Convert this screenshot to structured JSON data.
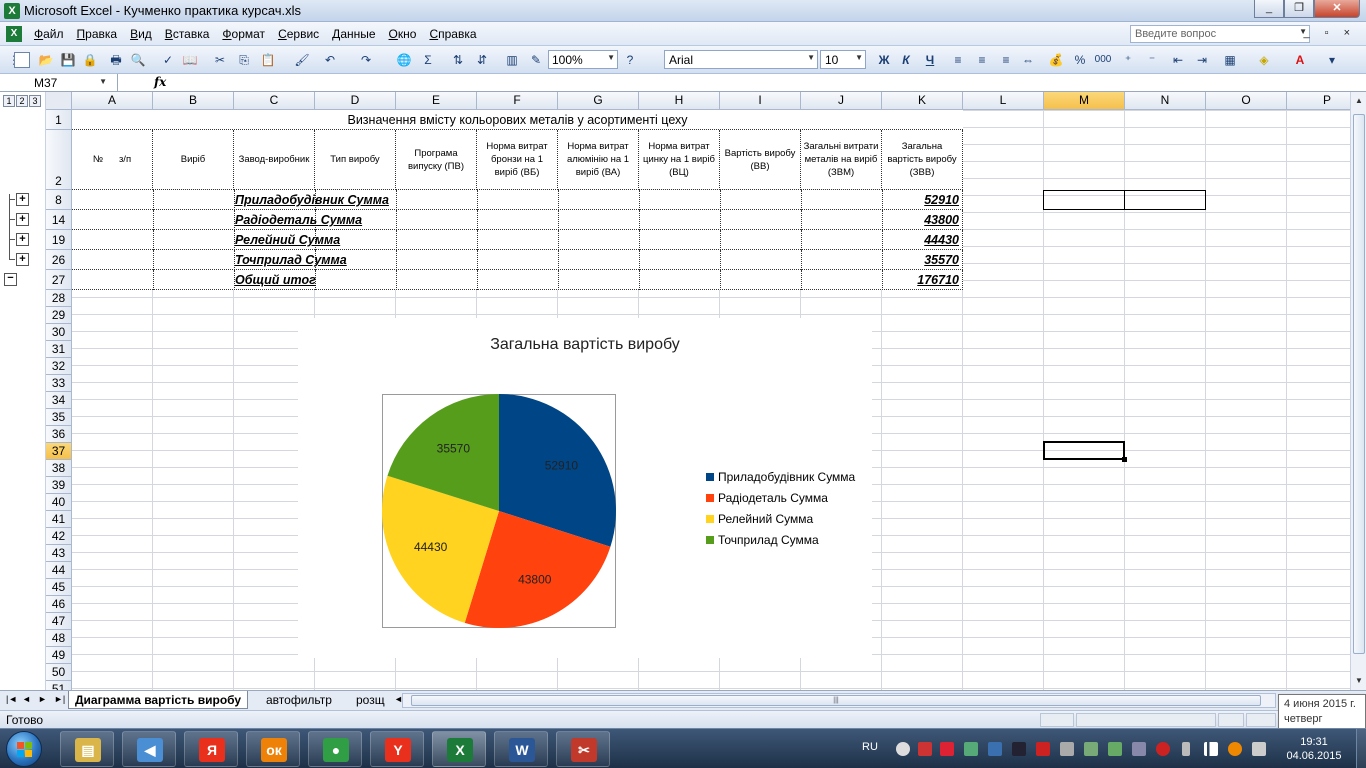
{
  "window": {
    "title": "Microsoft Excel - Кучменко практика курсач.xls",
    "minimize": "_",
    "restore": "❐",
    "close": "✕"
  },
  "menu": {
    "items": [
      "Файл",
      "Правка",
      "Вид",
      "Вставка",
      "Формат",
      "Сервис",
      "Данные",
      "Окно",
      "Справка"
    ],
    "help_placeholder": "Введите вопрос",
    "doc_controls": "_ ▫ ×"
  },
  "toolbar": {
    "zoom": "100%",
    "font": "Arial",
    "font_size": "10",
    "sigma": "Σ",
    "bold": "Ж",
    "italic": "К",
    "underline": "Ч",
    "percent": "%",
    "thousands": "000"
  },
  "formula": {
    "name_box": "M37",
    "fx": "fx",
    "content": ""
  },
  "sheet": {
    "columns": [
      "A",
      "B",
      "C",
      "D",
      "E",
      "F",
      "G",
      "H",
      "I",
      "J",
      "K",
      "L",
      "M",
      "N",
      "O",
      "P"
    ],
    "selected_column": "M",
    "rows": [
      "1",
      "2",
      "8",
      "14",
      "19",
      "26",
      "27",
      "28",
      "29",
      "30",
      "31",
      "32",
      "33",
      "34",
      "35",
      "36",
      "37",
      "38",
      "39",
      "40",
      "41",
      "42",
      "43",
      "44",
      "45",
      "46",
      "47",
      "48",
      "49",
      "50",
      "51"
    ],
    "selected_row": "37",
    "outline_levels": [
      "1",
      "2",
      "3"
    ],
    "title": "Визначення вмісту кольорових металів у асортименті цеху",
    "headers": {
      "a1": "№",
      "a2": "з/п",
      "b": "Виріб",
      "c": "Завод-виробник",
      "d": "Тип виробу",
      "e": "Програма випуску (ПВ)",
      "f": "Норма витрат бронзи на 1 виріб (ВБ)",
      "g": "Норма витрат алюмінію на 1 виріб (ВА)",
      "h": "Норма витрат цинку на 1 виріб (ВЦ)",
      "i": "Вартість виробу (ВВ)",
      "j": "Загальні витрати металів на виріб (ЗВМ)",
      "k": "Загальна вартість виробу (ЗВВ)"
    },
    "data_rows": [
      {
        "label": "Приладобудівник Сумма",
        "value": "52910"
      },
      {
        "label": "Радіодеталь Сумма",
        "value": "43800"
      },
      {
        "label": "Релейний Сумма",
        "value": "44430"
      },
      {
        "label": "Точприлад Сумма",
        "value": "35570"
      },
      {
        "label": "Общий итог",
        "value": "176710"
      }
    ]
  },
  "chart_data": {
    "type": "pie",
    "title": "Загальна вартість виробу",
    "categories": [
      "Приладобудівник Сумма",
      "Радіодеталь Сумма",
      "Релейний Сумма",
      "Точприлад Сумма"
    ],
    "values": [
      52910,
      43800,
      44430,
      35570
    ],
    "data_labels": [
      "52910",
      "43800",
      "44430",
      "35570"
    ],
    "colors": [
      "#004586",
      "#ff420e",
      "#ffd320",
      "#579d1c"
    ],
    "legend_position": "right"
  },
  "tabs": {
    "nav": [
      "|◄",
      "◄",
      "►",
      "►|"
    ],
    "sheets": [
      "Диаграмма вартість виробу",
      "автофильтр",
      "розщ"
    ],
    "active": "Диаграмма вартість виробу",
    "hscroll_grip": "|||"
  },
  "status": {
    "text": "Готово"
  },
  "tooltip": {
    "date": "4 июня 2015 г.",
    "weekday": "четверг"
  },
  "taskbar": {
    "apps": [
      {
        "name": "file-explorer-icon",
        "glyph": "▤",
        "color": "#d9b54a"
      },
      {
        "name": "media-player-icon",
        "glyph": "◀",
        "color": "#4a8fd4"
      },
      {
        "name": "yandex-icon",
        "glyph": "Я",
        "color": "#e8301c"
      },
      {
        "name": "odnoklassniki-icon",
        "glyph": "ок",
        "color": "#ee8208"
      },
      {
        "name": "chrome-icon",
        "glyph": "●",
        "color": "#2f9e44"
      },
      {
        "name": "yandex-browser-icon",
        "glyph": "Y",
        "color": "#e8301c"
      },
      {
        "name": "excel-icon",
        "glyph": "X",
        "color": "#1d7b3a"
      },
      {
        "name": "word-icon",
        "glyph": "W",
        "color": "#2b5797"
      },
      {
        "name": "paint-icon",
        "glyph": "✂",
        "color": "#c0392b"
      }
    ],
    "active_app": "excel-icon",
    "lang": "RU",
    "time": "19:31",
    "date": "04.06.2015"
  }
}
